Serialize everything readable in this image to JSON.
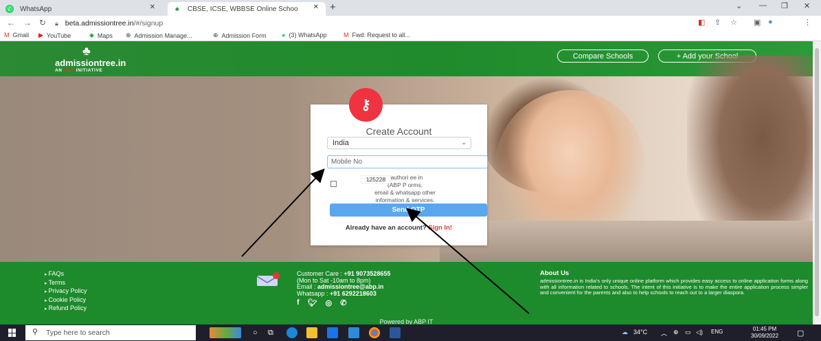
{
  "browser": {
    "tabs": [
      {
        "label": "WhatsApp",
        "active": false
      },
      {
        "label": "CBSE, ICSE, WBBSE Online Schoo",
        "active": true
      }
    ],
    "new_tab": "+",
    "window_controls": {
      "minimize": "—",
      "restore": "❐",
      "close": "✕",
      "tab_search": "⌄"
    },
    "url_host": "beta.admissiontree.in",
    "url_path": "/#/signup",
    "bookmarks": [
      "Gmail",
      "YouTube",
      "Maps",
      "Admission Manage...",
      "Admission Form",
      "(3) WhatsApp",
      "Fwd: Request to all..."
    ]
  },
  "site": {
    "logo_name": "admissiontree.in",
    "logo_tag_prefix": "AN ",
    "logo_tag_abp": "ABP",
    "logo_tag_suffix": " INITIATIVE",
    "compare_label": "Compare Schools",
    "add_school_label": "+ Add your School"
  },
  "signup": {
    "title": "Create Account",
    "country": "India",
    "mobile_placeholder": "Mobile No",
    "consent_line1": "I authori    ee in",
    "consent_line2": "(ABP P       orms,",
    "consent_line3": "email & whatsapp other",
    "consent_line4": "information & services.",
    "captcha": "125228",
    "send_otp": "Send OTP",
    "already_text": "Already have an account?",
    "sign_in": "Sign In!"
  },
  "footer": {
    "links": [
      "FAQs",
      "Terms",
      "Privacy Policy",
      "Cookie Policy",
      "Refund Policy"
    ],
    "customer_care_label": "Customer Care : ",
    "customer_care_number": "+91 9073528655",
    "hours": "(Mon to Sat -10am to 8pm)",
    "email_label": "Email : ",
    "email": "admissiontree@abp.in",
    "whatsapp_label": "Whatsapp : ",
    "whatsapp": "+91 6292218603",
    "about_heading": "About Us",
    "about_text": "admissiontree.in is India's only unique online platform which provides easy access to online application forms along with all information related to schools. The intent of this initiative is to make the entire application process simpler and convenient for the parents and also to help schools to reach out to a larger diaspora.",
    "powered_by": "Powered by ABP IT"
  },
  "taskbar": {
    "search_placeholder": "Type here to search",
    "weather": "34°C",
    "language": "ENG",
    "time": "01:45 PM",
    "date": "30/09/2022"
  },
  "colors": {
    "site_green": "#1d8a2b",
    "accent_red": "#ef3340",
    "button_blue": "#5aa7f0"
  }
}
